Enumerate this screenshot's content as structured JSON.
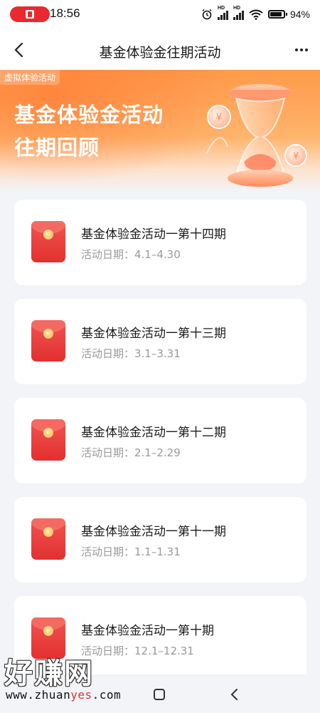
{
  "status_bar": {
    "time": "18:56",
    "battery": "94%",
    "icons": [
      "alarm-icon",
      "signal-icon",
      "signal-icon",
      "wifi-icon",
      "battery-icon"
    ]
  },
  "nav": {
    "title": "基金体验金往期活动",
    "back_icon": "chevron-left-icon",
    "more_icon": "more-horizontal-icon"
  },
  "banner": {
    "tag": "虚拟体验活动",
    "line1": "基金体验金活动",
    "line2": "往期回顾"
  },
  "activities": [
    {
      "title": "基金体验金活动一第十四期",
      "date": "活动日期：4.1–4.30"
    },
    {
      "title": "基金体验金活动一第十三期",
      "date": "活动日期：3.1–3.31"
    },
    {
      "title": "基金体验金活动一第十二期",
      "date": "活动日期：2.1–2.29"
    },
    {
      "title": "基金体验金活动一第十一期",
      "date": "活动日期：1.1–1.31"
    },
    {
      "title": "基金体验金活动一第十期",
      "date": "活动日期：12.1–12.31"
    }
  ],
  "watermark": {
    "big": "好赚网",
    "url_pre": "www.zhuan",
    "url_mid": "yes",
    "url_post": ".com"
  },
  "colors": {
    "accent": "#ff9a4a",
    "envelope": "#e8392f"
  }
}
